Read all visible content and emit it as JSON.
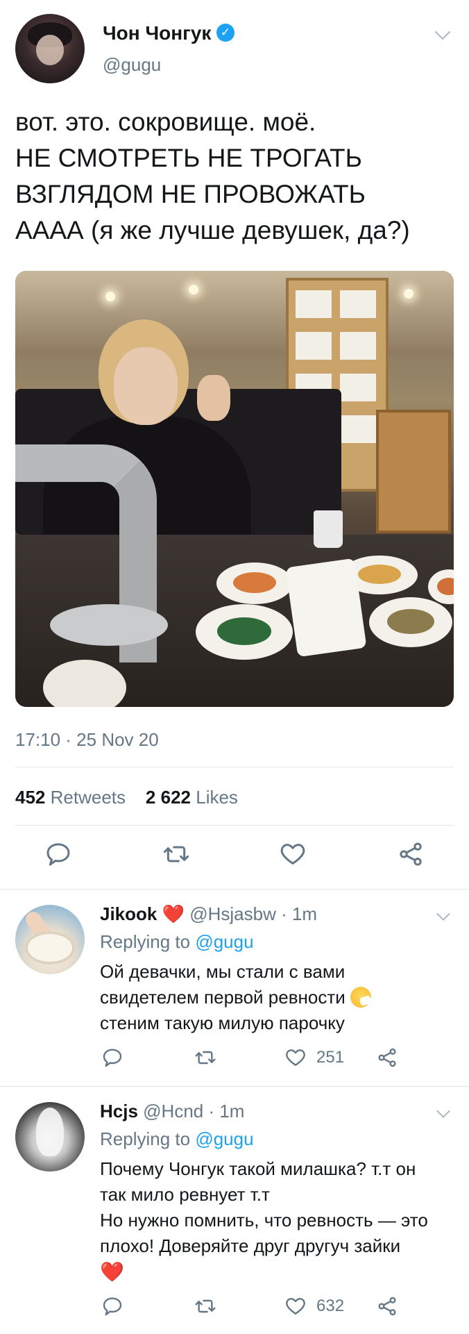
{
  "main_tweet": {
    "author_name": "Чон Чонгук",
    "verified_mark": "✓",
    "handle": "@gugu",
    "text_lines": [
      "вот. это. сокровище. моё.",
      "НЕ СМОТРЕТЬ НЕ ТРОГАТЬ",
      "ВЗГЛЯДОМ НЕ ПРОВОЖАТЬ",
      "АААА (я же лучше девушек, да?)"
    ],
    "timestamp": "17:10 · 25 Nov 20",
    "retweets_count": "452",
    "retweets_label": "Retweets",
    "likes_count": "2 622",
    "likes_label": "Likes"
  },
  "replies": [
    {
      "name": "Jikook",
      "name_emoji": "❤️",
      "handle_time": "@Hsjasbw · 1m",
      "replying_prefix": "Replying to",
      "replying_handle": "@gugu",
      "text_lines": [
        "Ой девачки, мы стали с вами",
        "свидетелем первой ревности",
        "стеним такую милую парочку"
      ],
      "like_count": "251"
    },
    {
      "name": "Hcjs",
      "handle_time": "@Hcnd · 1m",
      "replying_prefix": "Replying to",
      "replying_handle": "@gugu",
      "text_lines": [
        "Почему Чонгук такой милашка? т.т он",
        "так мило ревнует т.т",
        "Но нужно помнить, что ревность — это",
        "плохо! Доверяйте друг другуч зайки"
      ],
      "trailing_emoji": "❤️",
      "like_count": "632"
    }
  ],
  "colors": {
    "text": "#14171a",
    "muted": "#657786",
    "link": "#1da1f2",
    "verified": "#1da1f2",
    "divider": "#e1e8ed",
    "heart": "#e0245e"
  }
}
